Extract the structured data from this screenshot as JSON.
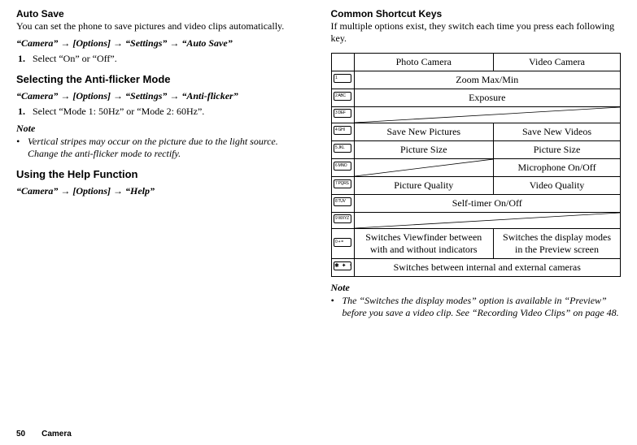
{
  "left": {
    "h_auto_save": "Auto Save",
    "auto_save_desc": "You can set the phone to save pictures and video clips automatically.",
    "path_auto_save": "“Camera” → [Options] → “Settings” → “Auto Save”",
    "step_auto_save": "Select “On” or “Off”.",
    "h_antiflicker": "Selecting the Anti-flicker Mode",
    "path_antiflicker": "“Camera” → [Options] → “Settings” → “Anti-flicker”",
    "step_antiflicker": "Select “Mode 1: 50Hz” or “Mode 2: 60Hz”.",
    "note_label": "Note",
    "note_antiflicker": "Vertical stripes may occur on the picture due to the light source. Change the anti-flicker mode to rectify.",
    "h_help": "Using the Help Function",
    "path_help": "“Camera” → [Options] → “Help”"
  },
  "right": {
    "h_shortcut": "Common Shortcut Keys",
    "shortcut_desc": "If multiple options exist, they switch each time you press each following key.",
    "th_photo": "Photo Camera",
    "th_video": "Video Camera",
    "k1": "1",
    "k1_label": "",
    "k2": "2",
    "k2_label": "ABC",
    "k3": "3",
    "k3_label": "DEF",
    "k4": "4",
    "k4_label": "GHI",
    "k5": "5",
    "k5_label": "JKL",
    "k6": "6",
    "k6_label": "MNO",
    "k7": "7",
    "k7_label": "PQRS",
    "k8": "8",
    "k8_label": "TUV",
    "k9": "9",
    "k9_label": "WXYZ",
    "k0": "0",
    "k0_label": "+ =",
    "kstar": "✱ ✦ ⚬",
    "r1": "Zoom Max/Min",
    "r2": "Exposure",
    "r4_photo": "Save New Pictures",
    "r4_video": "Save New Videos",
    "r5_photo": "Picture Size",
    "r5_video": "Picture Size",
    "r6_video": "Microphone On/Off",
    "r7_photo": "Picture Quality",
    "r7_video": "Video Quality",
    "r8": "Self-timer On/Off",
    "r0_photo": "Switches Viewfinder between with and without indicators",
    "r0_video": "Switches the display modes in the Preview screen",
    "rstar": "Switches between internal and external cameras",
    "note_label": "Note",
    "note_text": "The “Switches the display modes” option is available in “Preview” before you save a video clip. See “Recording Video Clips” on page 48."
  },
  "footer": {
    "page": "50",
    "section": "Camera"
  }
}
